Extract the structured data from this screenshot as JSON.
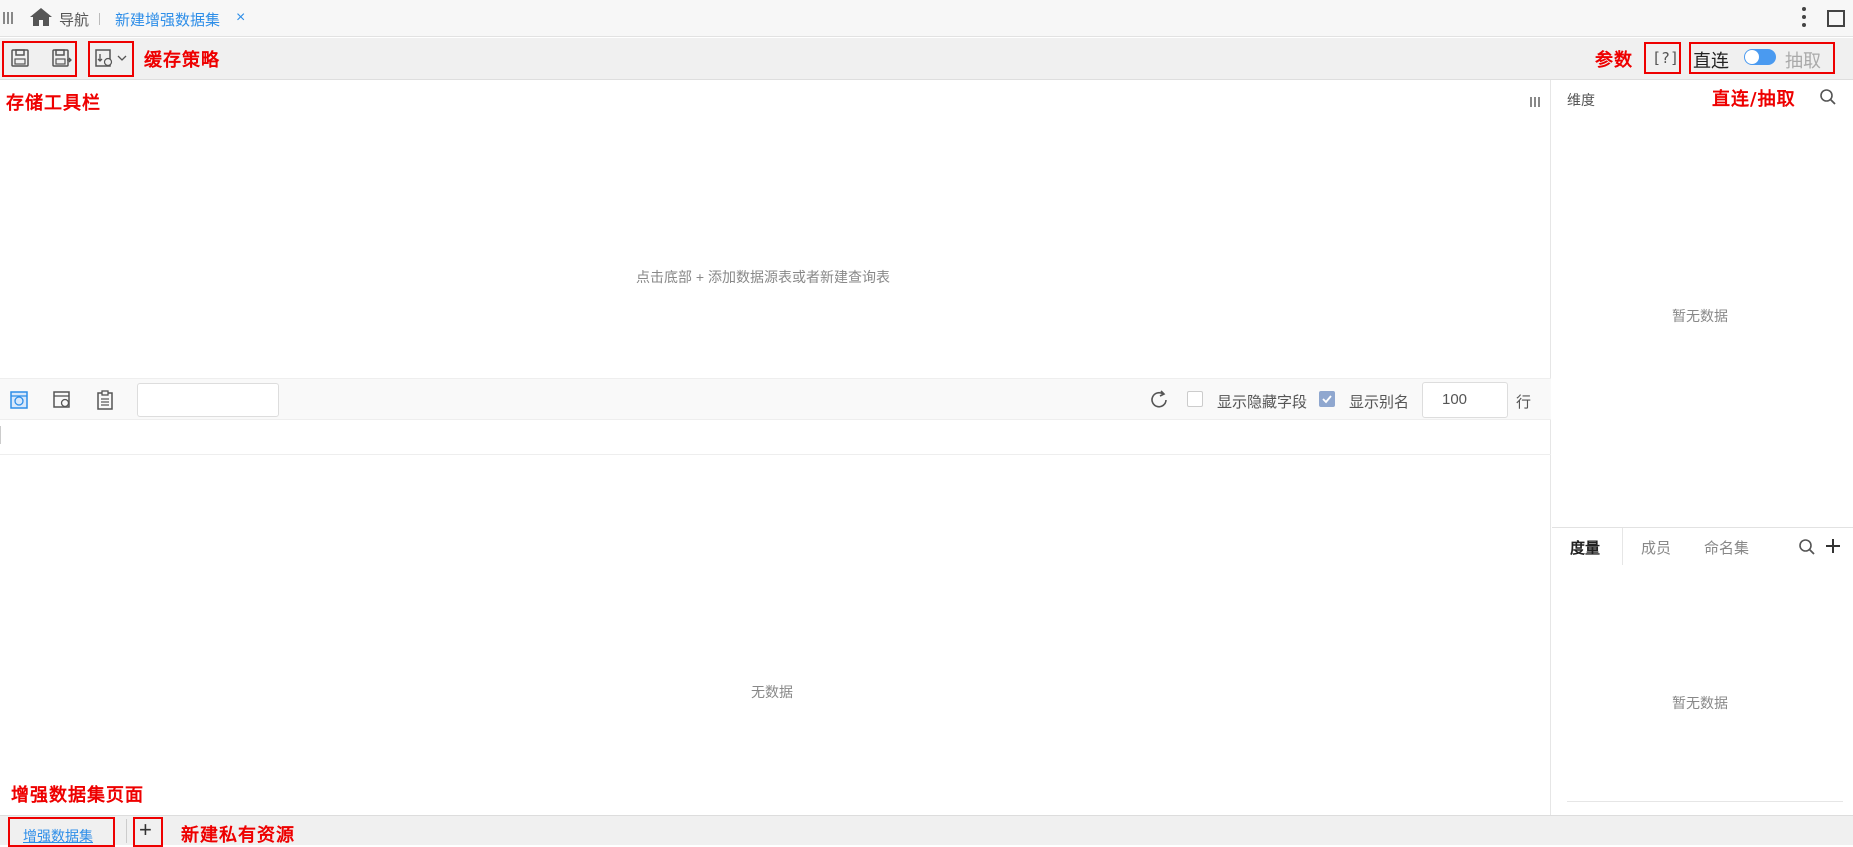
{
  "tabbar": {
    "nav_label": "导航",
    "active_tab": "新建增强数据集",
    "close_glyph": "×"
  },
  "toolbar": {
    "cache_label": "缓存策略",
    "params_label": "参数",
    "params_glyph": "[?]",
    "direct_label": "直连",
    "extract_label": "抽取",
    "mode_anno": "直连/抽取",
    "storage_anno": "存储工具栏"
  },
  "canvas": {
    "hint": "点击底部 + 添加数据源表或者新建查询表"
  },
  "data_toolbar": {
    "show_hidden_label": "显示隐藏字段",
    "show_hidden_checked": false,
    "show_alias_label": "显示别名",
    "show_alias_checked": true,
    "rows_value": "100",
    "rows_unit": "行"
  },
  "grid": {
    "empty_text": "无数据"
  },
  "right_panel": {
    "dimension_title": "维度",
    "dimension_empty": "暂无数据",
    "tabs": [
      "度量",
      "成员",
      "命名集"
    ],
    "measure_empty": "暂无数据"
  },
  "bottom": {
    "page_anno": "增强数据集页面",
    "tab_label": "增强数据集",
    "add_glyph": "+",
    "add_anno": "新建私有资源"
  },
  "colors": {
    "accent": "#2e8ee8",
    "annotation": "#e00000"
  }
}
